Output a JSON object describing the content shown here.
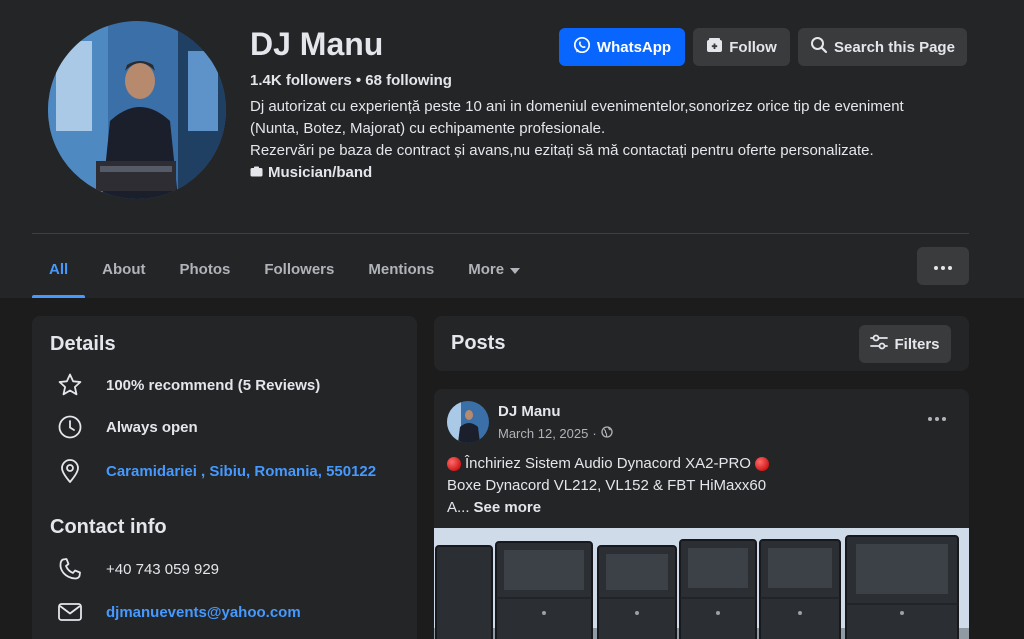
{
  "profile": {
    "name": "DJ Manu",
    "stats": "1.4K followers • 68 following",
    "bio_line1": "Dj autorizat cu experiență peste 10 ani in domeniul evenimentelor,sonorizez orice tip de eveniment",
    "bio_line2": "(Nunta, Botez, Majorat) cu echipamente profesionale.",
    "bio_line3": "Rezervări pe baza de contract și avans,nu ezitați să mă contactați pentru oferte personalizate.",
    "category": "Musician/band"
  },
  "actions": {
    "whatsapp": "WhatsApp",
    "follow": "Follow",
    "search": "Search this Page"
  },
  "tabs": [
    {
      "label": "All",
      "active": true
    },
    {
      "label": "About"
    },
    {
      "label": "Photos"
    },
    {
      "label": "Followers"
    },
    {
      "label": "Mentions"
    },
    {
      "label": "More"
    }
  ],
  "details": {
    "title": "Details",
    "recommend": "100% recommend (5 Reviews)",
    "hours": "Always open",
    "address": "Caramidariei , Sibiu, Romania, 550122"
  },
  "contact": {
    "title": "Contact info",
    "phone": "+40 743 059 929",
    "email": "djmanuevents@yahoo.com"
  },
  "posts": {
    "title": "Posts",
    "filters": "Filters"
  },
  "post": {
    "author": "DJ Manu",
    "date": "March 12, 2025",
    "line1": "Închiriez Sistem Audio Dynacord XA2-PRO",
    "line2": "Boxe Dynacord VL212, VL152 & FBT HiMaxx60",
    "line3_prefix": "A...",
    "see_more": "See more"
  },
  "colors": {
    "accent": "#0866ff",
    "link": "#4599ff",
    "background": "#1c1c1d",
    "surface": "#242526"
  }
}
